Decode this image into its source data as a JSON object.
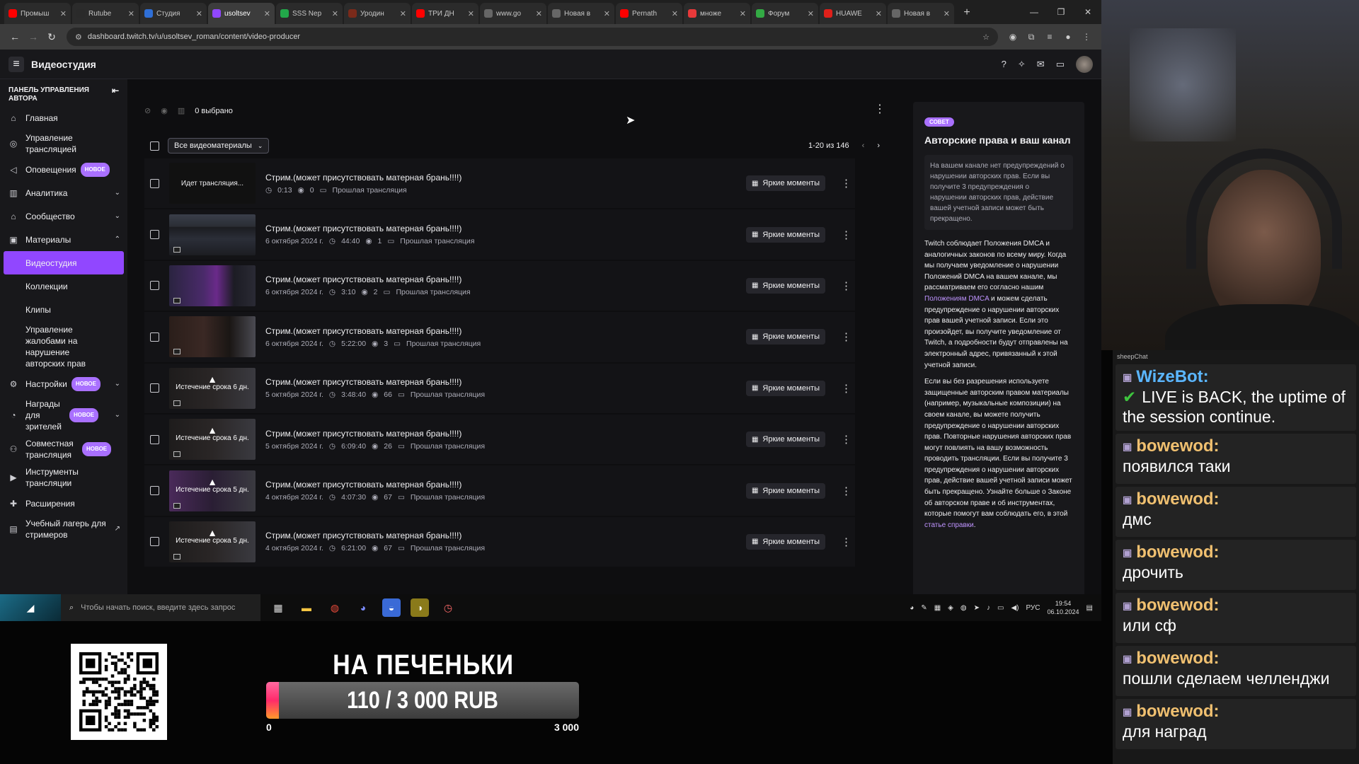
{
  "browser": {
    "tabs": [
      {
        "label": "Промыш",
        "color": "#ff0000",
        "active": false
      },
      {
        "label": "Rutube ",
        "color": "#2a2a2a",
        "active": false
      },
      {
        "label": "Студия ",
        "color": "#2f6fd6",
        "active": false
      },
      {
        "label": "usoltsev",
        "color": "#9147ff",
        "active": true
      },
      {
        "label": "SSS Nep",
        "color": "#22a84a",
        "active": false
      },
      {
        "label": "Уродин",
        "color": "#7a2a1a",
        "active": false
      },
      {
        "label": "ТРИ ДН",
        "color": "#ff0000",
        "active": false
      },
      {
        "label": "www.go",
        "color": "#666666",
        "active": false
      },
      {
        "label": "Новая в",
        "color": "#666666",
        "active": false
      },
      {
        "label": "Pernath",
        "color": "#ff0000",
        "active": false
      },
      {
        "label": "множе",
        "color": "#e8393a",
        "active": false
      },
      {
        "label": "Форум ",
        "color": "#33aa44",
        "active": false
      },
      {
        "label": "HUAWE",
        "color": "#e0201a",
        "active": false
      },
      {
        "label": "Новая в",
        "color": "#666666",
        "active": false
      }
    ],
    "url": "dashboard.twitch.tv/u/usoltsev_roman/content/video-producer"
  },
  "app": {
    "title": "Видеостудия"
  },
  "sidebar": {
    "header": "ПАНЕЛЬ УПРАВЛЕНИЯ АВТОРА",
    "new_badge": "НОВОЕ",
    "items": {
      "home": "Главная",
      "stream_mgmt": "Управление трансляцией",
      "alerts": "Оповещения",
      "analytics": "Аналитика",
      "community": "Сообщество",
      "materials": "Материалы",
      "video_studio": "Видеостудия",
      "collections": "Коллекции",
      "clips": "Клипы",
      "copyright": "Управление жалобами на нарушение авторских прав",
      "settings": "Настройки",
      "rewards": "Награды для зрителей",
      "collab": "Совместная трансляция",
      "tools": "Инструменты трансляции",
      "extensions": "Расширения",
      "bootcamp": "Учебный лагерь для стримеров"
    }
  },
  "toolbar": {
    "selected": "0 выбрано",
    "filter": "Все видеоматериалы",
    "pagination": "1-20 из 146"
  },
  "videos": [
    {
      "title": "Стрим.(может присутствовать матерная брань!!!!)",
      "thumb": "live",
      "overlay": "Идет трансляция...",
      "date": "",
      "duration": "0:13",
      "views": "0",
      "type": "Прошлая трансляция",
      "highlights": "Яркие моменты"
    },
    {
      "title": "Стрим.(может присутствовать матерная брань!!!!)",
      "thumb": "img1",
      "overlay": "",
      "date": "6 октября 2024 г.",
      "duration": "44:40",
      "views": "1",
      "type": "Прошлая трансляция",
      "highlights": "Яркие моменты"
    },
    {
      "title": "Стрим.(может присутствовать матерная брань!!!!)",
      "thumb": "img2",
      "overlay": "",
      "date": "6 октября 2024 г.",
      "duration": "3:10",
      "views": "2",
      "type": "Прошлая трансляция",
      "highlights": "Яркие моменты"
    },
    {
      "title": "Стрим.(может присутствовать матерная брань!!!!)",
      "thumb": "img3",
      "overlay": "",
      "date": "6 октября 2024 г.",
      "duration": "5:22:00",
      "views": "3",
      "type": "Прошлая трансляция",
      "highlights": "Яркие моменты"
    },
    {
      "title": "Стрим.(может присутствовать матерная брань!!!!)",
      "thumb": "exp",
      "overlay": "Истечение срока 6 дн.",
      "date": "5 октября 2024 г.",
      "duration": "3:48:40",
      "views": "66",
      "type": "Прошлая трансляция",
      "highlights": "Яркие моменты"
    },
    {
      "title": "Стрим.(может присутствовать матерная брань!!!!)",
      "thumb": "exp",
      "overlay": "Истечение срока 6 дн.",
      "date": "5 октября 2024 г.",
      "duration": "6:09:40",
      "views": "26",
      "type": "Прошлая трансляция",
      "highlights": "Яркие моменты"
    },
    {
      "title": "Стрим.(может присутствовать матерная брань!!!!)",
      "thumb": "exp2",
      "overlay": "Истечение срока 5 дн.",
      "date": "4 октября 2024 г.",
      "duration": "4:07:30",
      "views": "67",
      "type": "Прошлая трансляция",
      "highlights": "Яркие моменты"
    },
    {
      "title": "Стрим.(может присутствовать матерная брань!!!!)",
      "thumb": "exp",
      "overlay": "Истечение срока 5 дн.",
      "date": "4 октября 2024 г.",
      "duration": "6:21:00",
      "views": "67",
      "type": "Прошлая трансляция",
      "highlights": "Яркие моменты"
    }
  ],
  "tip": {
    "badge": "СОВЕТ",
    "title": "Авторские права и ваш канал",
    "box": "На вашем канале нет предупреждений о нарушении авторских прав. Если вы получите 3 предупреждения о нарушении авторских прав, действие вашей учетной записи может быть прекращено.",
    "p1_before": "Twitch соблюдает Положения DMCA и аналогичных законов по всему миру. Когда мы получаем уведомление о нарушении Положений DMCA на вашем канале, мы рассматриваем его согласно нашим ",
    "p1_link": "Положениям DMCA",
    "p1_after": " и можем сделать предупреждение о нарушении авторских прав вашей учетной записи. Если это произойдет, вы получите уведомление от Twitch, а подробности будут отправлены на электронный адрес, привязанный к этой учетной записи.",
    "p2_before": "Если вы без разрешения используете защищенные авторским правом материалы (например, музыкальные композиции) на своем канале, вы можете получить предупреждение о нарушении авторских прав. Повторные нарушения авторских прав могут повлиять на вашу возможность проводить трансляции. Если вы получите 3 предупреждения о нарушении авторских прав, действие вашей учетной записи может быть прекращено. Узнайте больше о Законе об авторском праве и об инструментах, которые помогут вам соблюдать его, в этой ",
    "p2_link": "статье справки",
    "p2_after": "."
  },
  "taskbar": {
    "search_placeholder": "Чтобы начать поиск, введите здесь запрос",
    "lang": "РУС",
    "time": "19:54",
    "date": "06.10.2024"
  },
  "chat": {
    "header": "sheepChat",
    "messages": [
      {
        "nick": "WizeBot:",
        "text": "LIVE is BACK, the uptime of the session continue.",
        "bot": true
      },
      {
        "nick": "bowewod:",
        "text": "появился таки",
        "bot": false
      },
      {
        "nick": "bowewod:",
        "text": "дмс",
        "bot": false
      },
      {
        "nick": "bowewod:",
        "text": "дрочить",
        "bot": false
      },
      {
        "nick": "bowewod:",
        "text": "или сф",
        "bot": false
      },
      {
        "nick": "bowewod:",
        "text": "пошли сделаем челленджи",
        "bot": false
      },
      {
        "nick": "bowewod:",
        "text": "для наград",
        "bot": false
      }
    ]
  },
  "goal": {
    "title": "НА ПЕЧЕНЬКИ",
    "label": "110 / 3 000 RUB",
    "current": 110,
    "target": 3000,
    "min_label": "0",
    "max_label": "3 000"
  }
}
